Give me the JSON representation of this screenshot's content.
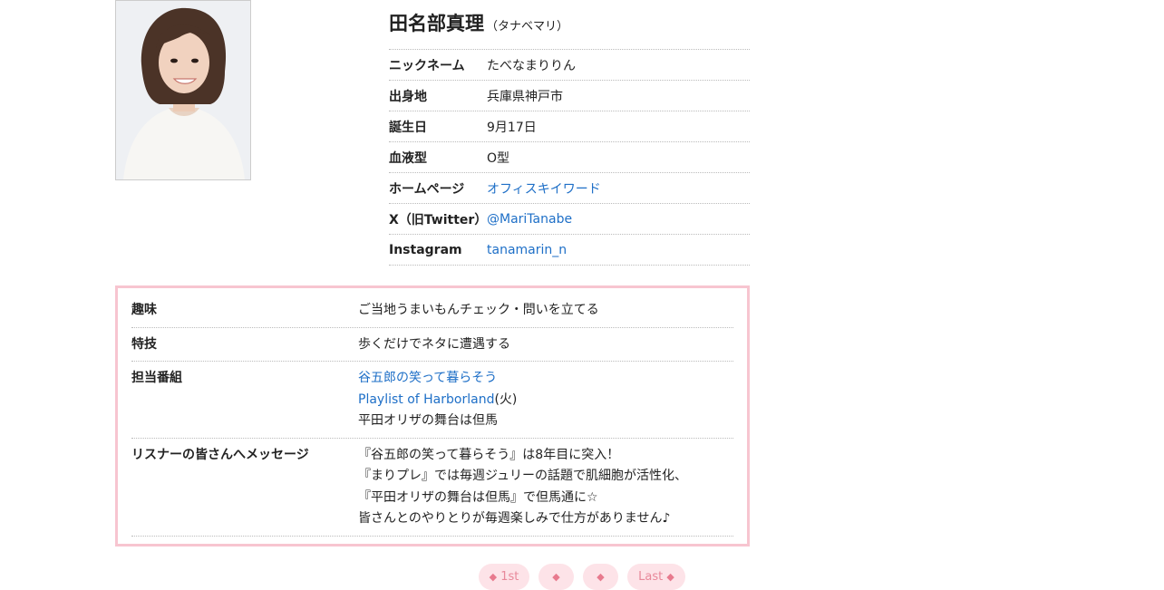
{
  "profile": {
    "name": "田名部真理",
    "kana": "（タナベマリ）",
    "rows": [
      {
        "label": "ニックネーム",
        "value": "たべなまりりん"
      },
      {
        "label": "出身地",
        "value": "兵庫県神戸市"
      },
      {
        "label": "誕生日",
        "value": "9月17日"
      },
      {
        "label": "血液型",
        "value": "O型"
      },
      {
        "label": "ホームページ",
        "value": "オフィスキイワード"
      },
      {
        "label": "X（旧Twitter）",
        "value": "@MariTanabe"
      },
      {
        "label": "Instagram",
        "value": "tanamarin_n"
      }
    ]
  },
  "details": {
    "hobby": {
      "label": "趣味",
      "value": "ご当地うまいもんチェック・問いを立てる"
    },
    "skill": {
      "label": "特技",
      "value": "歩くだけでネタに遭遇する"
    },
    "programs": {
      "label": "担当番組",
      "items": [
        {
          "text": "谷五郎の笑って暮らそう"
        },
        {
          "text": "Playlist of Harborland",
          "suffix": "(火)"
        },
        {
          "text": "平田オリザの舞台は但馬"
        }
      ]
    },
    "message": {
      "label": "リスナーの皆さんへメッセージ",
      "lines": [
        "『谷五郎の笑って暮らそう』は8年目に突入！",
        "『まりプレ』では毎週ジュリーの話題で肌細胞が活性化、",
        "『平田オリザの舞台は但馬』で但馬通に☆",
        "皆さんとのやりとりが毎週楽しみで仕方がありません♪"
      ]
    }
  },
  "pager": {
    "first_label": "1st",
    "last_label": "Last"
  },
  "colors": {
    "accent_pink_border": "#f7c5d0",
    "pager_bg": "#fde3e8",
    "link": "#1e6fc7"
  }
}
